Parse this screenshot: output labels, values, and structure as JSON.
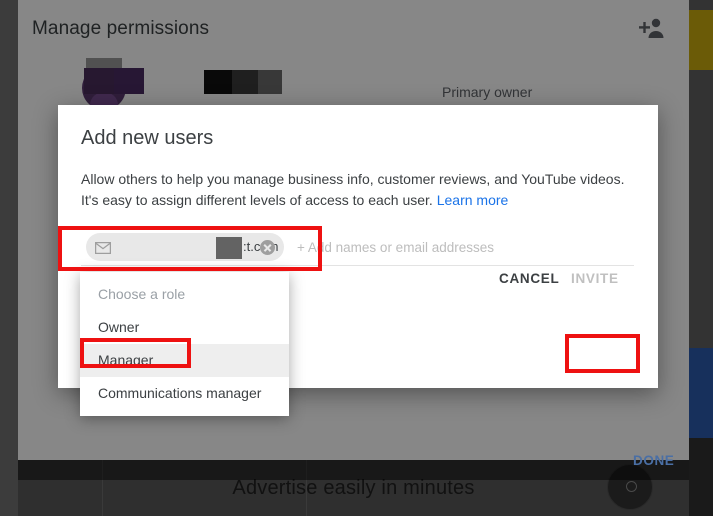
{
  "background": {
    "page_title": "Manage permissions",
    "add_users_icon": "add-person-icon",
    "user_row": {
      "name_redacted": "",
      "role_label": "Primary owner"
    },
    "done_label": "DONE",
    "promo_banner": "Advertise easily in minutes"
  },
  "dialog": {
    "title": "Add new users",
    "description_line1": "Allow others to help you manage business info, customer reviews, and YouTube videos.",
    "description_line2": "It's easy to assign different levels of access to each user.",
    "learn_more_label": "Learn more",
    "recipient_field": {
      "chip_icon": "envelope-icon",
      "chip_text": ":t.com",
      "chip_remove_icon": "close-circle-icon",
      "placeholder": "+ Add names or email addresses"
    },
    "cancel_label": "CANCEL",
    "invite_label": "INVITE",
    "invite_disabled": true
  },
  "role_dropdown": {
    "placeholder_label": "Choose a role",
    "options": [
      {
        "label": "Owner",
        "selected": false
      },
      {
        "label": "Manager",
        "selected": true
      },
      {
        "label": "Communications manager",
        "selected": false
      }
    ]
  },
  "annotations": {
    "highlight_color": "#ee1111",
    "boxes": [
      "recipient-field",
      "manager-option",
      "invite-button"
    ]
  },
  "colors": {
    "link_blue": "#1a73e8",
    "done_blue": "#4a6fa5",
    "dialog_bg": "#ffffff",
    "overlay": "rgba(0,0,0,0.47)"
  }
}
